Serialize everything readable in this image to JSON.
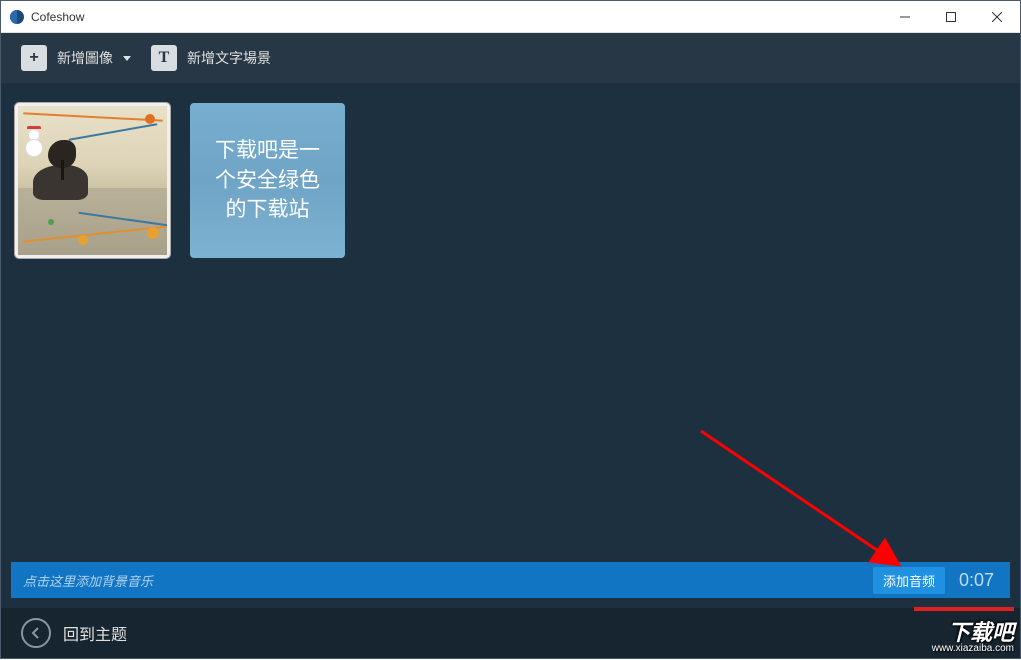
{
  "app": {
    "title": "Cofeshow"
  },
  "toolbar": {
    "add_image_label": "新增圖像",
    "add_text_scene_label": "新增文字場景",
    "plus_glyph": "+",
    "t_glyph": "T"
  },
  "slides": [
    {
      "type": "image",
      "selected": true
    },
    {
      "type": "text",
      "text": "下载吧是一个安全绿色的下载站"
    }
  ],
  "music": {
    "placeholder": "点击这里添加背景音乐",
    "add_audio_label": "添加音频",
    "duration": "0:07"
  },
  "footer": {
    "back_label": "回到主题"
  },
  "watermark": {
    "brand": "下载吧",
    "url": "www.xiazaiba.com"
  }
}
